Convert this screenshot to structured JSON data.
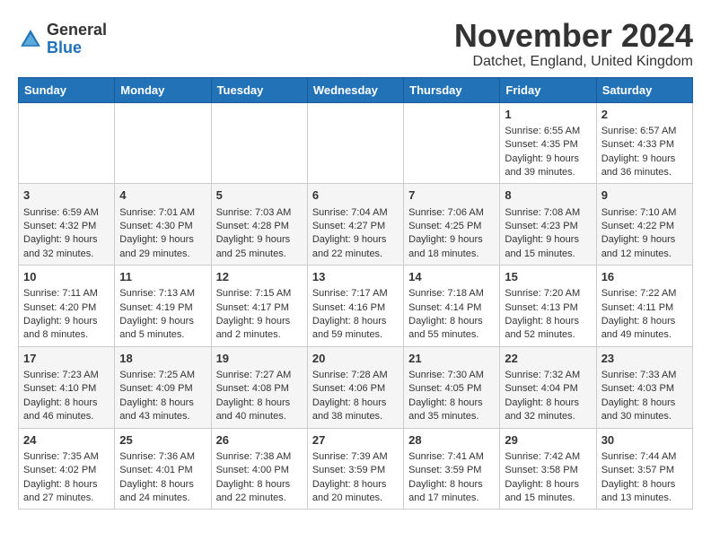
{
  "logo": {
    "general": "General",
    "blue": "Blue"
  },
  "header": {
    "month_title": "November 2024",
    "subtitle": "Datchet, England, United Kingdom"
  },
  "weekdays": [
    "Sunday",
    "Monday",
    "Tuesday",
    "Wednesday",
    "Thursday",
    "Friday",
    "Saturday"
  ],
  "weeks": [
    [
      {
        "day": "",
        "info": ""
      },
      {
        "day": "",
        "info": ""
      },
      {
        "day": "",
        "info": ""
      },
      {
        "day": "",
        "info": ""
      },
      {
        "day": "",
        "info": ""
      },
      {
        "day": "1",
        "info": "Sunrise: 6:55 AM\nSunset: 4:35 PM\nDaylight: 9 hours and 39 minutes."
      },
      {
        "day": "2",
        "info": "Sunrise: 6:57 AM\nSunset: 4:33 PM\nDaylight: 9 hours and 36 minutes."
      }
    ],
    [
      {
        "day": "3",
        "info": "Sunrise: 6:59 AM\nSunset: 4:32 PM\nDaylight: 9 hours and 32 minutes."
      },
      {
        "day": "4",
        "info": "Sunrise: 7:01 AM\nSunset: 4:30 PM\nDaylight: 9 hours and 29 minutes."
      },
      {
        "day": "5",
        "info": "Sunrise: 7:03 AM\nSunset: 4:28 PM\nDaylight: 9 hours and 25 minutes."
      },
      {
        "day": "6",
        "info": "Sunrise: 7:04 AM\nSunset: 4:27 PM\nDaylight: 9 hours and 22 minutes."
      },
      {
        "day": "7",
        "info": "Sunrise: 7:06 AM\nSunset: 4:25 PM\nDaylight: 9 hours and 18 minutes."
      },
      {
        "day": "8",
        "info": "Sunrise: 7:08 AM\nSunset: 4:23 PM\nDaylight: 9 hours and 15 minutes."
      },
      {
        "day": "9",
        "info": "Sunrise: 7:10 AM\nSunset: 4:22 PM\nDaylight: 9 hours and 12 minutes."
      }
    ],
    [
      {
        "day": "10",
        "info": "Sunrise: 7:11 AM\nSunset: 4:20 PM\nDaylight: 9 hours and 8 minutes."
      },
      {
        "day": "11",
        "info": "Sunrise: 7:13 AM\nSunset: 4:19 PM\nDaylight: 9 hours and 5 minutes."
      },
      {
        "day": "12",
        "info": "Sunrise: 7:15 AM\nSunset: 4:17 PM\nDaylight: 9 hours and 2 minutes."
      },
      {
        "day": "13",
        "info": "Sunrise: 7:17 AM\nSunset: 4:16 PM\nDaylight: 8 hours and 59 minutes."
      },
      {
        "day": "14",
        "info": "Sunrise: 7:18 AM\nSunset: 4:14 PM\nDaylight: 8 hours and 55 minutes."
      },
      {
        "day": "15",
        "info": "Sunrise: 7:20 AM\nSunset: 4:13 PM\nDaylight: 8 hours and 52 minutes."
      },
      {
        "day": "16",
        "info": "Sunrise: 7:22 AM\nSunset: 4:11 PM\nDaylight: 8 hours and 49 minutes."
      }
    ],
    [
      {
        "day": "17",
        "info": "Sunrise: 7:23 AM\nSunset: 4:10 PM\nDaylight: 8 hours and 46 minutes."
      },
      {
        "day": "18",
        "info": "Sunrise: 7:25 AM\nSunset: 4:09 PM\nDaylight: 8 hours and 43 minutes."
      },
      {
        "day": "19",
        "info": "Sunrise: 7:27 AM\nSunset: 4:08 PM\nDaylight: 8 hours and 40 minutes."
      },
      {
        "day": "20",
        "info": "Sunrise: 7:28 AM\nSunset: 4:06 PM\nDaylight: 8 hours and 38 minutes."
      },
      {
        "day": "21",
        "info": "Sunrise: 7:30 AM\nSunset: 4:05 PM\nDaylight: 8 hours and 35 minutes."
      },
      {
        "day": "22",
        "info": "Sunrise: 7:32 AM\nSunset: 4:04 PM\nDaylight: 8 hours and 32 minutes."
      },
      {
        "day": "23",
        "info": "Sunrise: 7:33 AM\nSunset: 4:03 PM\nDaylight: 8 hours and 30 minutes."
      }
    ],
    [
      {
        "day": "24",
        "info": "Sunrise: 7:35 AM\nSunset: 4:02 PM\nDaylight: 8 hours and 27 minutes."
      },
      {
        "day": "25",
        "info": "Sunrise: 7:36 AM\nSunset: 4:01 PM\nDaylight: 8 hours and 24 minutes."
      },
      {
        "day": "26",
        "info": "Sunrise: 7:38 AM\nSunset: 4:00 PM\nDaylight: 8 hours and 22 minutes."
      },
      {
        "day": "27",
        "info": "Sunrise: 7:39 AM\nSunset: 3:59 PM\nDaylight: 8 hours and 20 minutes."
      },
      {
        "day": "28",
        "info": "Sunrise: 7:41 AM\nSunset: 3:59 PM\nDaylight: 8 hours and 17 minutes."
      },
      {
        "day": "29",
        "info": "Sunrise: 7:42 AM\nSunset: 3:58 PM\nDaylight: 8 hours and 15 minutes."
      },
      {
        "day": "30",
        "info": "Sunrise: 7:44 AM\nSunset: 3:57 PM\nDaylight: 8 hours and 13 minutes."
      }
    ]
  ]
}
